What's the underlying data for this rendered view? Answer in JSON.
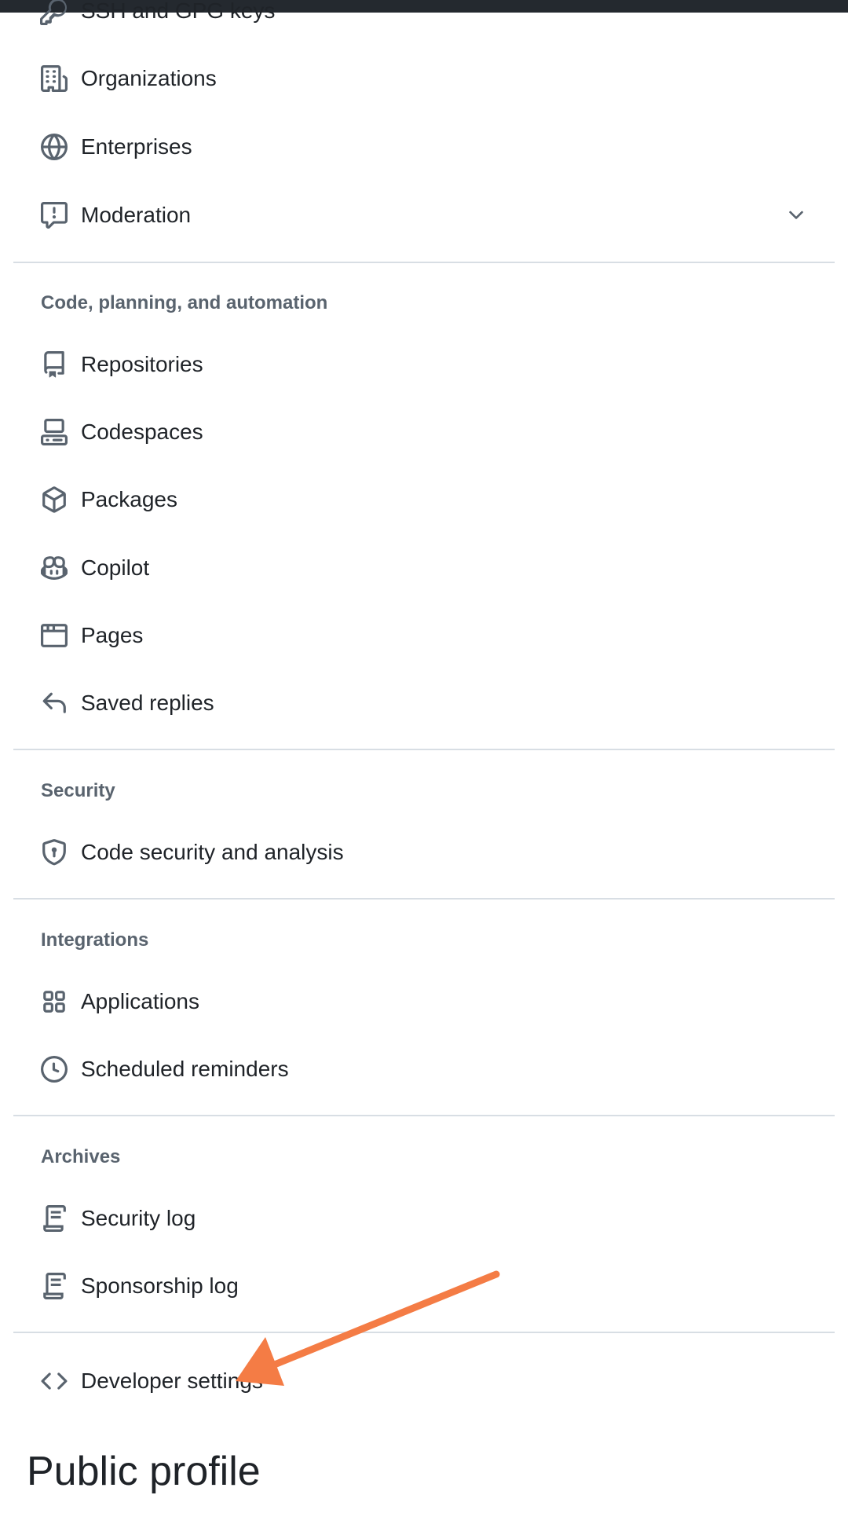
{
  "nav": {
    "cutoff_label": "SSH and GPG keys",
    "access_items": [
      {
        "label": "Organizations",
        "icon": "organization-icon"
      },
      {
        "label": "Enterprises",
        "icon": "globe-icon"
      },
      {
        "label": "Moderation",
        "icon": "report-icon"
      }
    ],
    "code_section": {
      "heading": "Code, planning, and automation",
      "items": [
        {
          "label": "Repositories",
          "icon": "repo-icon"
        },
        {
          "label": "Codespaces",
          "icon": "codespaces-icon"
        },
        {
          "label": "Packages",
          "icon": "package-icon"
        },
        {
          "label": "Copilot",
          "icon": "copilot-icon"
        },
        {
          "label": "Pages",
          "icon": "browser-icon"
        },
        {
          "label": "Saved replies",
          "icon": "reply-icon"
        }
      ]
    },
    "security_section": {
      "heading": "Security",
      "items": [
        {
          "label": "Code security and analysis",
          "icon": "shield-lock-icon"
        }
      ]
    },
    "integrations_section": {
      "heading": "Integrations",
      "items": [
        {
          "label": "Applications",
          "icon": "apps-icon"
        },
        {
          "label": "Scheduled reminders",
          "icon": "clock-icon"
        }
      ]
    },
    "archives_section": {
      "heading": "Archives",
      "items": [
        {
          "label": "Security log",
          "icon": "log-icon"
        },
        {
          "label": "Sponsorship log",
          "icon": "log-icon"
        }
      ]
    },
    "developer_settings": {
      "label": "Developer settings",
      "icon": "code-icon"
    }
  },
  "main": {
    "title": "Public profile"
  },
  "colors": {
    "text": "#1f2328",
    "muted": "#59636e",
    "divider": "#d8dee4",
    "annotation_arrow": "#f47c45",
    "topbar": "#24292f"
  }
}
